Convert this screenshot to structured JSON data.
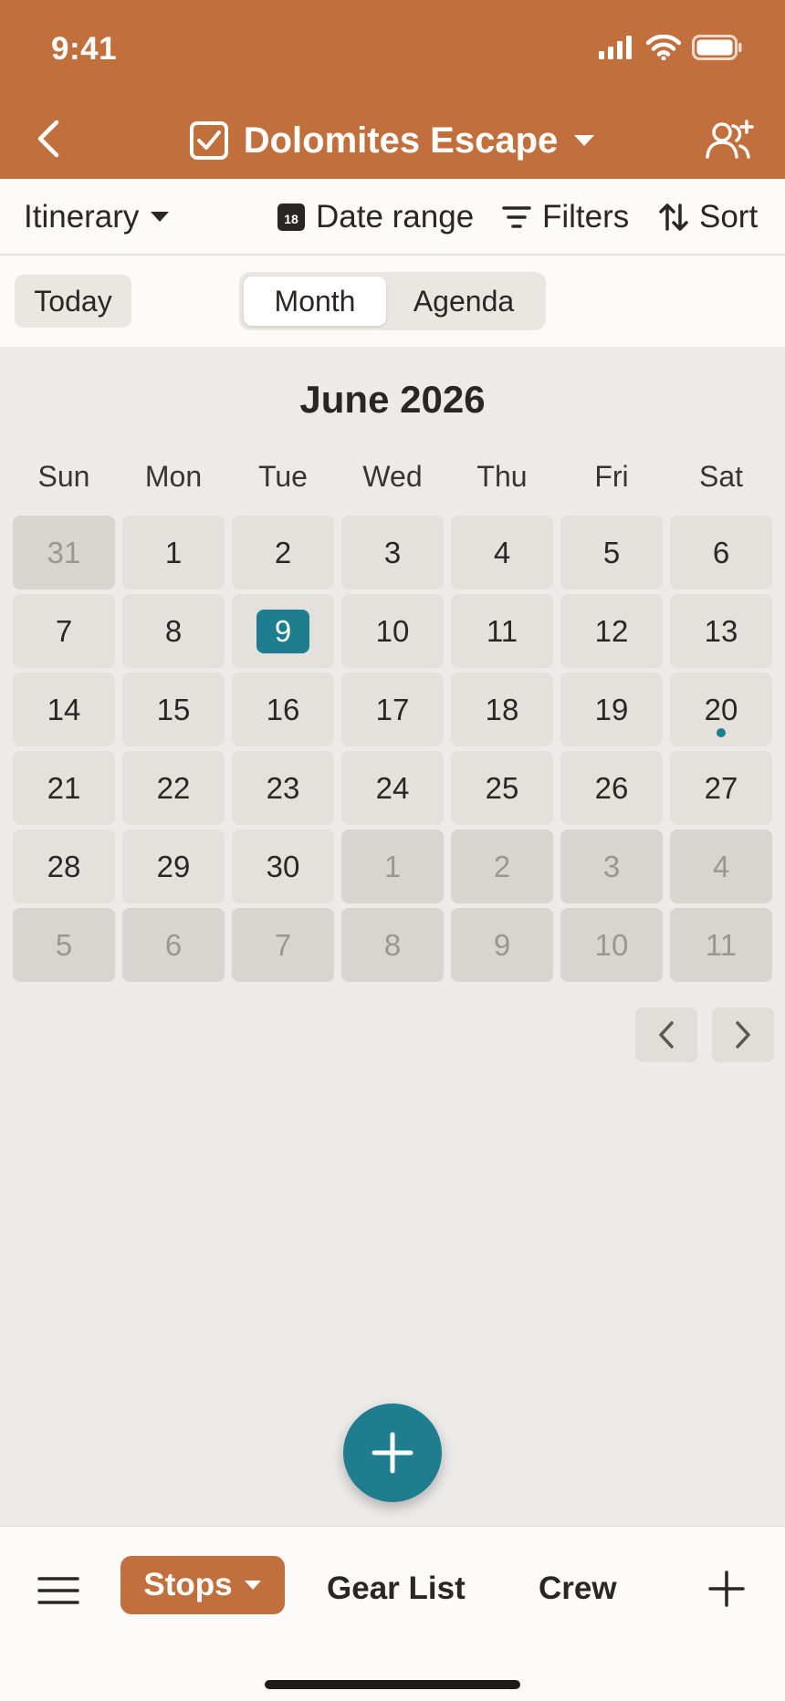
{
  "status_bar": {
    "time": "9:41"
  },
  "nav": {
    "title": "Dolomites Escape"
  },
  "toolbar": {
    "view_label": "Itinerary",
    "date_badge": "18",
    "date_range_label": "Date range",
    "filters_label": "Filters",
    "sort_label": "Sort"
  },
  "controls": {
    "today_label": "Today",
    "view_modes": [
      "Month",
      "Agenda"
    ],
    "active_view": "Month"
  },
  "calendar": {
    "month_title": "June 2026",
    "weekdays": [
      "Sun",
      "Mon",
      "Tue",
      "Wed",
      "Thu",
      "Fri",
      "Sat"
    ],
    "today": "9",
    "days": [
      {
        "label": "31",
        "current": false
      },
      {
        "label": "1",
        "current": true
      },
      {
        "label": "2",
        "current": true
      },
      {
        "label": "3",
        "current": true
      },
      {
        "label": "4",
        "current": true
      },
      {
        "label": "5",
        "current": true
      },
      {
        "label": "6",
        "current": true
      },
      {
        "label": "7",
        "current": true
      },
      {
        "label": "8",
        "current": true
      },
      {
        "label": "9",
        "current": true,
        "today": true
      },
      {
        "label": "10",
        "current": true
      },
      {
        "label": "11",
        "current": true
      },
      {
        "label": "12",
        "current": true
      },
      {
        "label": "13",
        "current": true
      },
      {
        "label": "14",
        "current": true
      },
      {
        "label": "15",
        "current": true
      },
      {
        "label": "16",
        "current": true
      },
      {
        "label": "17",
        "current": true
      },
      {
        "label": "18",
        "current": true
      },
      {
        "label": "19",
        "current": true
      },
      {
        "label": "20",
        "current": true,
        "event": true
      },
      {
        "label": "21",
        "current": true
      },
      {
        "label": "22",
        "current": true
      },
      {
        "label": "23",
        "current": true
      },
      {
        "label": "24",
        "current": true
      },
      {
        "label": "25",
        "current": true
      },
      {
        "label": "26",
        "current": true
      },
      {
        "label": "27",
        "current": true
      },
      {
        "label": "28",
        "current": true
      },
      {
        "label": "29",
        "current": true
      },
      {
        "label": "30",
        "current": true
      },
      {
        "label": "1",
        "current": false
      },
      {
        "label": "2",
        "current": false
      },
      {
        "label": "3",
        "current": false
      },
      {
        "label": "4",
        "current": false
      },
      {
        "label": "5",
        "current": false
      },
      {
        "label": "6",
        "current": false
      },
      {
        "label": "7",
        "current": false
      },
      {
        "label": "8",
        "current": false
      },
      {
        "label": "9",
        "current": false
      },
      {
        "label": "10",
        "current": false
      },
      {
        "label": "11",
        "current": false
      }
    ]
  },
  "tabbar": {
    "active_tab": "Stops",
    "tabs": [
      "Gear List",
      "Crew"
    ]
  },
  "colors": {
    "brand": "#C1703D",
    "accent": "#1E7D8F",
    "background": "#EDEBE8"
  }
}
